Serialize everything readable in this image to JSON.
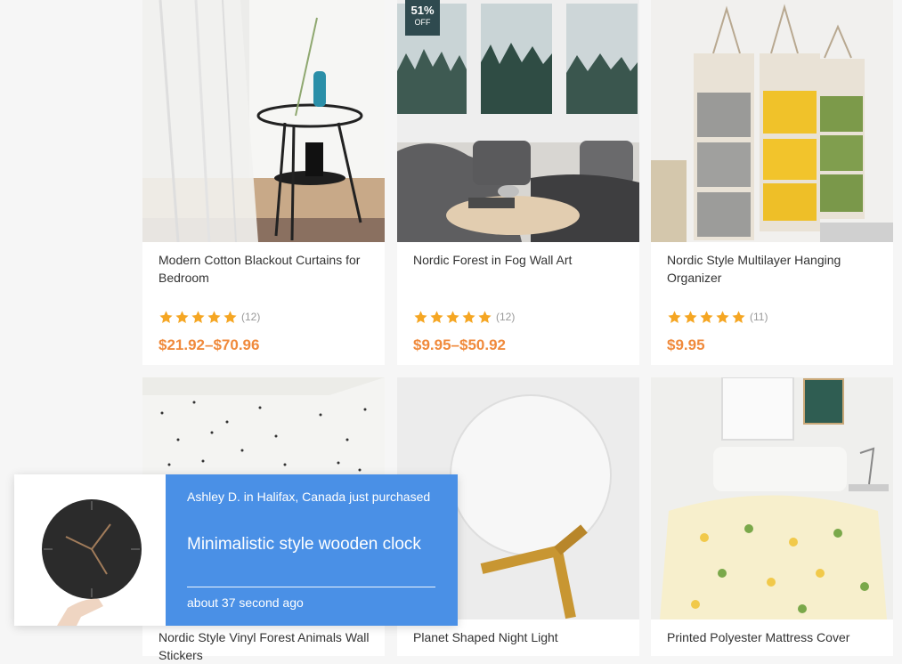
{
  "products": [
    {
      "title": "Modern Cotton Blackout Curtains for Bedroom",
      "rating_count": "(12)",
      "price": "$21.92–$70.96",
      "stars": 5
    },
    {
      "title": "Nordic Forest in Fog Wall Art",
      "rating_count": "(12)",
      "price": "$9.95–$50.92",
      "stars": 5,
      "badge": {
        "percent": "51%",
        "label": "OFF"
      }
    },
    {
      "title": "Nordic Style Multilayer Hanging Organizer",
      "rating_count": "(11)",
      "price": "$9.95",
      "stars": 5
    },
    {
      "title": "Nordic Style Vinyl Forest Animals Wall Stickers"
    },
    {
      "title": "Planet Shaped Night Light"
    },
    {
      "title": "Printed Polyester Mattress Cover"
    }
  ],
  "popup": {
    "buyer_text": "Ashley D. in Halifax, Canada just purchased",
    "product": "Minimalistic style wooden clock",
    "time_ago": "about 37 second ago"
  },
  "colors": {
    "price": "#f08a3c",
    "star": "#f5a623",
    "popup_bg": "#4a90e6",
    "badge_bg": "#2f4a4f"
  }
}
